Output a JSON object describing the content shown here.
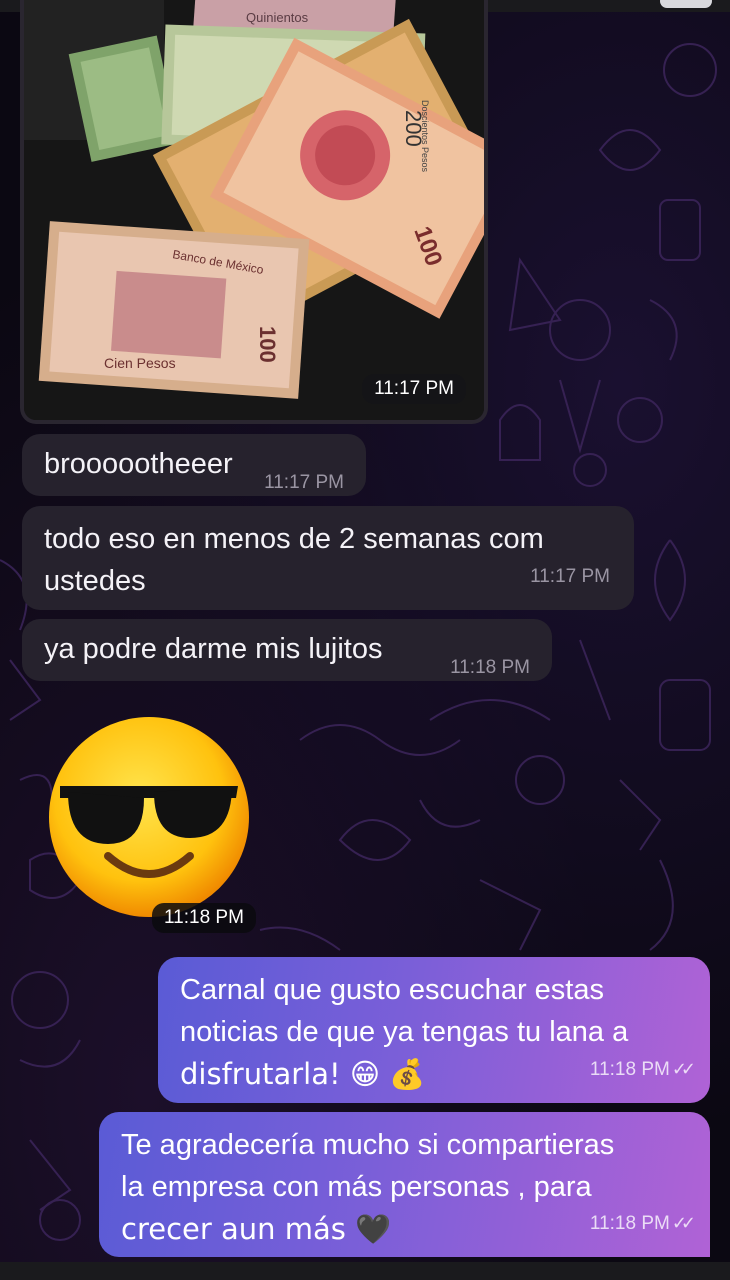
{
  "messages": {
    "photo": {
      "time": "11:17 PM"
    },
    "incoming": [
      {
        "text": "broooootheeer",
        "time": "11:17 PM"
      },
      {
        "text": "todo eso en menos de 2 semanas com ustedes",
        "line1": "todo eso en menos de 2 semanas com",
        "line2": "ustedes",
        "time": "11:17 PM"
      },
      {
        "text": "ya podre darme mis lujitos",
        "time": "11:18 PM"
      }
    ],
    "sticker": {
      "name": "sunglasses-emoji",
      "time": "11:18 PM"
    },
    "outgoing": [
      {
        "line1": "Carnal que gusto escuchar estas",
        "line2": "noticias de que ya tengas tu lana a",
        "line3": "disfrutarla! 😁 💰",
        "time": "11:18 PM",
        "status": "read"
      },
      {
        "line1": "Te agradecería mucho si compartieras",
        "line2": "la empresa con más personas , para",
        "line3": "crecer aun más 🖤",
        "time": "11:18 PM",
        "status": "read"
      }
    ]
  },
  "banknotes": {
    "note1": "Quinientos",
    "note2": "200",
    "note3": "Doscientos Pesos",
    "note4": "100",
    "note5": "Cien Pesos",
    "note6": "Banco de México"
  },
  "colors": {
    "background": "#0b0812",
    "incoming_bubble": "#26222d",
    "outgoing_gradient_start": "#5a5bd6",
    "outgoing_gradient_end": "#b062d6"
  }
}
